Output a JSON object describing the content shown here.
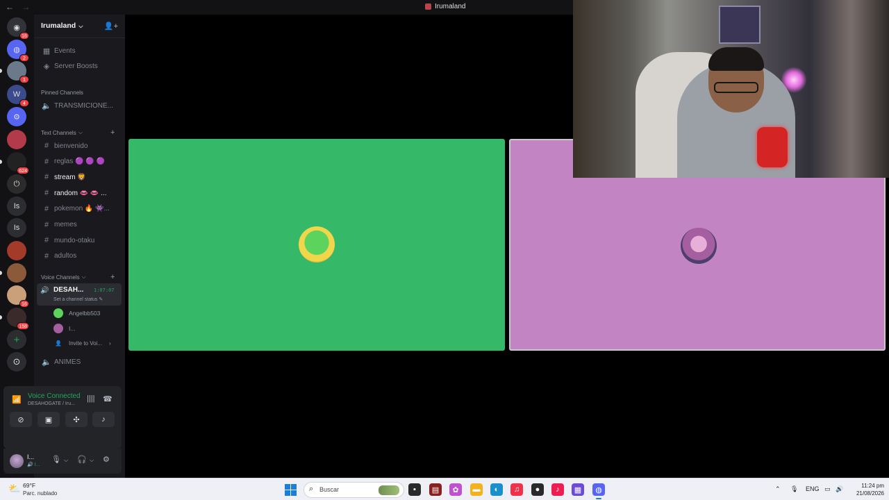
{
  "titlebar": {
    "back": "←",
    "forward": "→",
    "title": "Irumaland"
  },
  "rail": {
    "servers": [
      {
        "name": "dm-icon",
        "badge": "16",
        "color": "#313338",
        "glyph": "◉"
      },
      {
        "name": "discord-server",
        "badge": "2",
        "color": "#5865f2",
        "glyph": "◍"
      },
      {
        "name": "server-3",
        "badge": "1",
        "color": "#6b7a8a",
        "glyph": ""
      },
      {
        "name": "server-4",
        "badge": "4",
        "color": "#3a4a8a",
        "glyph": "W"
      },
      {
        "name": "server-5",
        "badge": "",
        "color": "#5865f2",
        "glyph": "⚙"
      },
      {
        "name": "server-6",
        "badge": "",
        "color": "#b33a4a",
        "glyph": ""
      },
      {
        "name": "server-7",
        "badge": "624",
        "color": "#222",
        "glyph": ""
      },
      {
        "name": "server-8",
        "badge": "",
        "color": "#2b2b2b",
        "glyph": "⏻"
      },
      {
        "name": "server-is-1",
        "badge": "",
        "color": "#2b2d31",
        "glyph": "Is"
      },
      {
        "name": "server-is-2",
        "badge": "",
        "color": "#2b2d31",
        "glyph": "Is"
      },
      {
        "name": "server-11",
        "badge": "",
        "color": "#a33a2a",
        "glyph": ""
      },
      {
        "name": "server-12",
        "badge": "",
        "color": "#8a5a3a",
        "glyph": ""
      },
      {
        "name": "server-13",
        "badge": "16",
        "color": "#c9a07a",
        "glyph": ""
      },
      {
        "name": "server-14",
        "badge": "158",
        "color": "#3a2a2a",
        "glyph": ""
      }
    ],
    "add_server": "+",
    "discover": "⊙"
  },
  "sidebar": {
    "server_name": "Irumaland",
    "menu": [
      {
        "icon": "▦",
        "label": "Events"
      },
      {
        "icon": "◈",
        "label": "Server Boosts"
      }
    ],
    "pinned_label": "Pinned Channels",
    "pinned": [
      {
        "icon": "🔊",
        "label": "TRANSMICIONE..."
      }
    ],
    "text_label": "Text Channels",
    "text_channels": [
      {
        "label": "bienvenido",
        "bold": false
      },
      {
        "label": "reglas 🟣 🟣 🟣",
        "bold": false
      },
      {
        "label": "stream 🦁",
        "bold": true
      },
      {
        "label": "random 👄 👄 ...",
        "bold": true
      },
      {
        "label": "pokemon 🔥 👾...",
        "bold": false
      },
      {
        "label": "memes",
        "bold": false
      },
      {
        "label": "mundo-otaku",
        "bold": false
      },
      {
        "label": "adultos",
        "bold": false
      }
    ],
    "voice_label": "Voice Channels",
    "active_voice": {
      "name": "DESAH...",
      "time": "1:07:07",
      "status": "Set a channel status ✎"
    },
    "voice_users": [
      {
        "label": "Angelbb503",
        "color": "#5bd35c"
      },
      {
        "label": "I...",
        "color": "#a55fa0"
      }
    ],
    "invite": "Invite to Voi...",
    "other_voice": {
      "label": "ANIMES"
    }
  },
  "voice_panel": {
    "connected": "Voice Connected",
    "location": "DESAHOGATE / Iru...",
    "buttons": [
      "camera-off-icon",
      "screen-share-icon",
      "activities-icon",
      "soundboard-icon"
    ]
  },
  "userbar": {
    "name": "I...",
    "status": "🔊 I..."
  },
  "taskbar": {
    "temp": "69°F",
    "condition": "Parc. nublado",
    "search_placeholder": "Buscar",
    "lang": "ENG",
    "time": "11:24 pm",
    "date": "21/08/2026"
  }
}
